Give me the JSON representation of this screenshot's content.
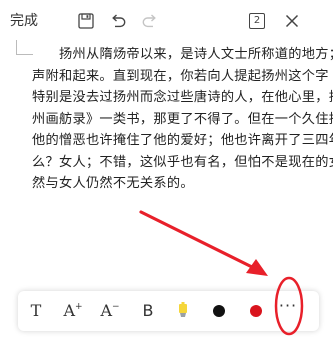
{
  "toolbar": {
    "done_label": "完成",
    "page_count": "2",
    "icons": [
      "save-icon",
      "undo-icon",
      "redo-icon",
      "page-count-icon",
      "close-icon"
    ]
  },
  "document": {
    "lines": [
      "扬州从隋炀帝以来，是诗人文士所称道的地方；",
      "声附和起来。直到现在，你若向人提起扬州这个字",
      "特别是没去过扬州而念过些唐诗的人，在他心里，扬",
      "州画舫录》一类书，那更了不得了。但在一个久住扬州",
      "他的憎恶也许掩住了他的爱好；他也许离开了三四年",
      "么？女人；不错，这似乎也有名，但怕不是现在的女",
      "然与女人仍然不无关系的。"
    ]
  },
  "format_bar": {
    "items": [
      {
        "name": "text-style-button",
        "label": "T"
      },
      {
        "name": "font-size-increase-button",
        "label": "A"
      },
      {
        "name": "font-size-decrease-button",
        "label": "A"
      },
      {
        "name": "bold-button",
        "label": "B"
      }
    ],
    "increase_sup": "+",
    "decrease_sup": "−",
    "highlight_color": "#f5d63a",
    "black_color": "#111111",
    "red_color": "#d9141d",
    "more_label": "···"
  },
  "annotation": {
    "arrow_color": "#e8202a",
    "circle_color": "#e8202a"
  }
}
